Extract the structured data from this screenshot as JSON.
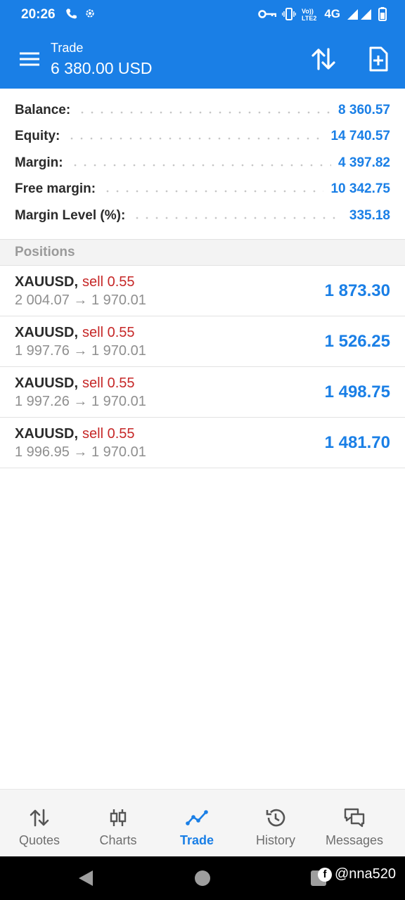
{
  "status_bar": {
    "time": "20:26",
    "network": "4G",
    "icons": [
      "call-icon",
      "settings-icon",
      "key-icon",
      "vibrate-icon",
      "volte-icon",
      "signal-icon",
      "battery-icon"
    ]
  },
  "app_bar": {
    "title": "Trade",
    "subtitle": "6 380.00 USD",
    "icons": [
      "menu-icon",
      "sort-icon",
      "new-order-icon"
    ]
  },
  "summary": [
    {
      "label": "Balance:",
      "value": "8 360.57"
    },
    {
      "label": "Equity:",
      "value": "14 740.57"
    },
    {
      "label": "Margin:",
      "value": "4 397.82"
    },
    {
      "label": "Free margin:",
      "value": "10 342.75"
    },
    {
      "label": "Margin Level (%):",
      "value": "335.18"
    }
  ],
  "positions_header": "Positions",
  "positions": [
    {
      "symbol": "XAUUSD,",
      "type": "sell 0.55",
      "prices": "2 004.07 → 1 970.01",
      "profit": "1 873.30"
    },
    {
      "symbol": "XAUUSD,",
      "type": "sell 0.55",
      "prices": "1 997.76 → 1 970.01",
      "profit": "1 526.25"
    },
    {
      "symbol": "XAUUSD,",
      "type": "sell 0.55",
      "prices": "1 997.26 → 1 970.01",
      "profit": "1 498.75"
    },
    {
      "symbol": "XAUUSD,",
      "type": "sell 0.55",
      "prices": "1 996.95 → 1 970.01",
      "profit": "1 481.70"
    }
  ],
  "bottom_nav": [
    {
      "label": "Quotes",
      "icon": "quotes-icon",
      "active": false
    },
    {
      "label": "Charts",
      "icon": "charts-icon",
      "active": false
    },
    {
      "label": "Trade",
      "icon": "trade-icon",
      "active": true
    },
    {
      "label": "History",
      "icon": "history-icon",
      "active": false
    },
    {
      "label": "Messages",
      "icon": "messages-icon",
      "active": false
    }
  ],
  "watermark": "@nna520",
  "colors": {
    "accent": "#1a7fe6",
    "sell": "#c62828",
    "muted": "#8f8f8f",
    "header_bg": "#1a7fe6"
  }
}
